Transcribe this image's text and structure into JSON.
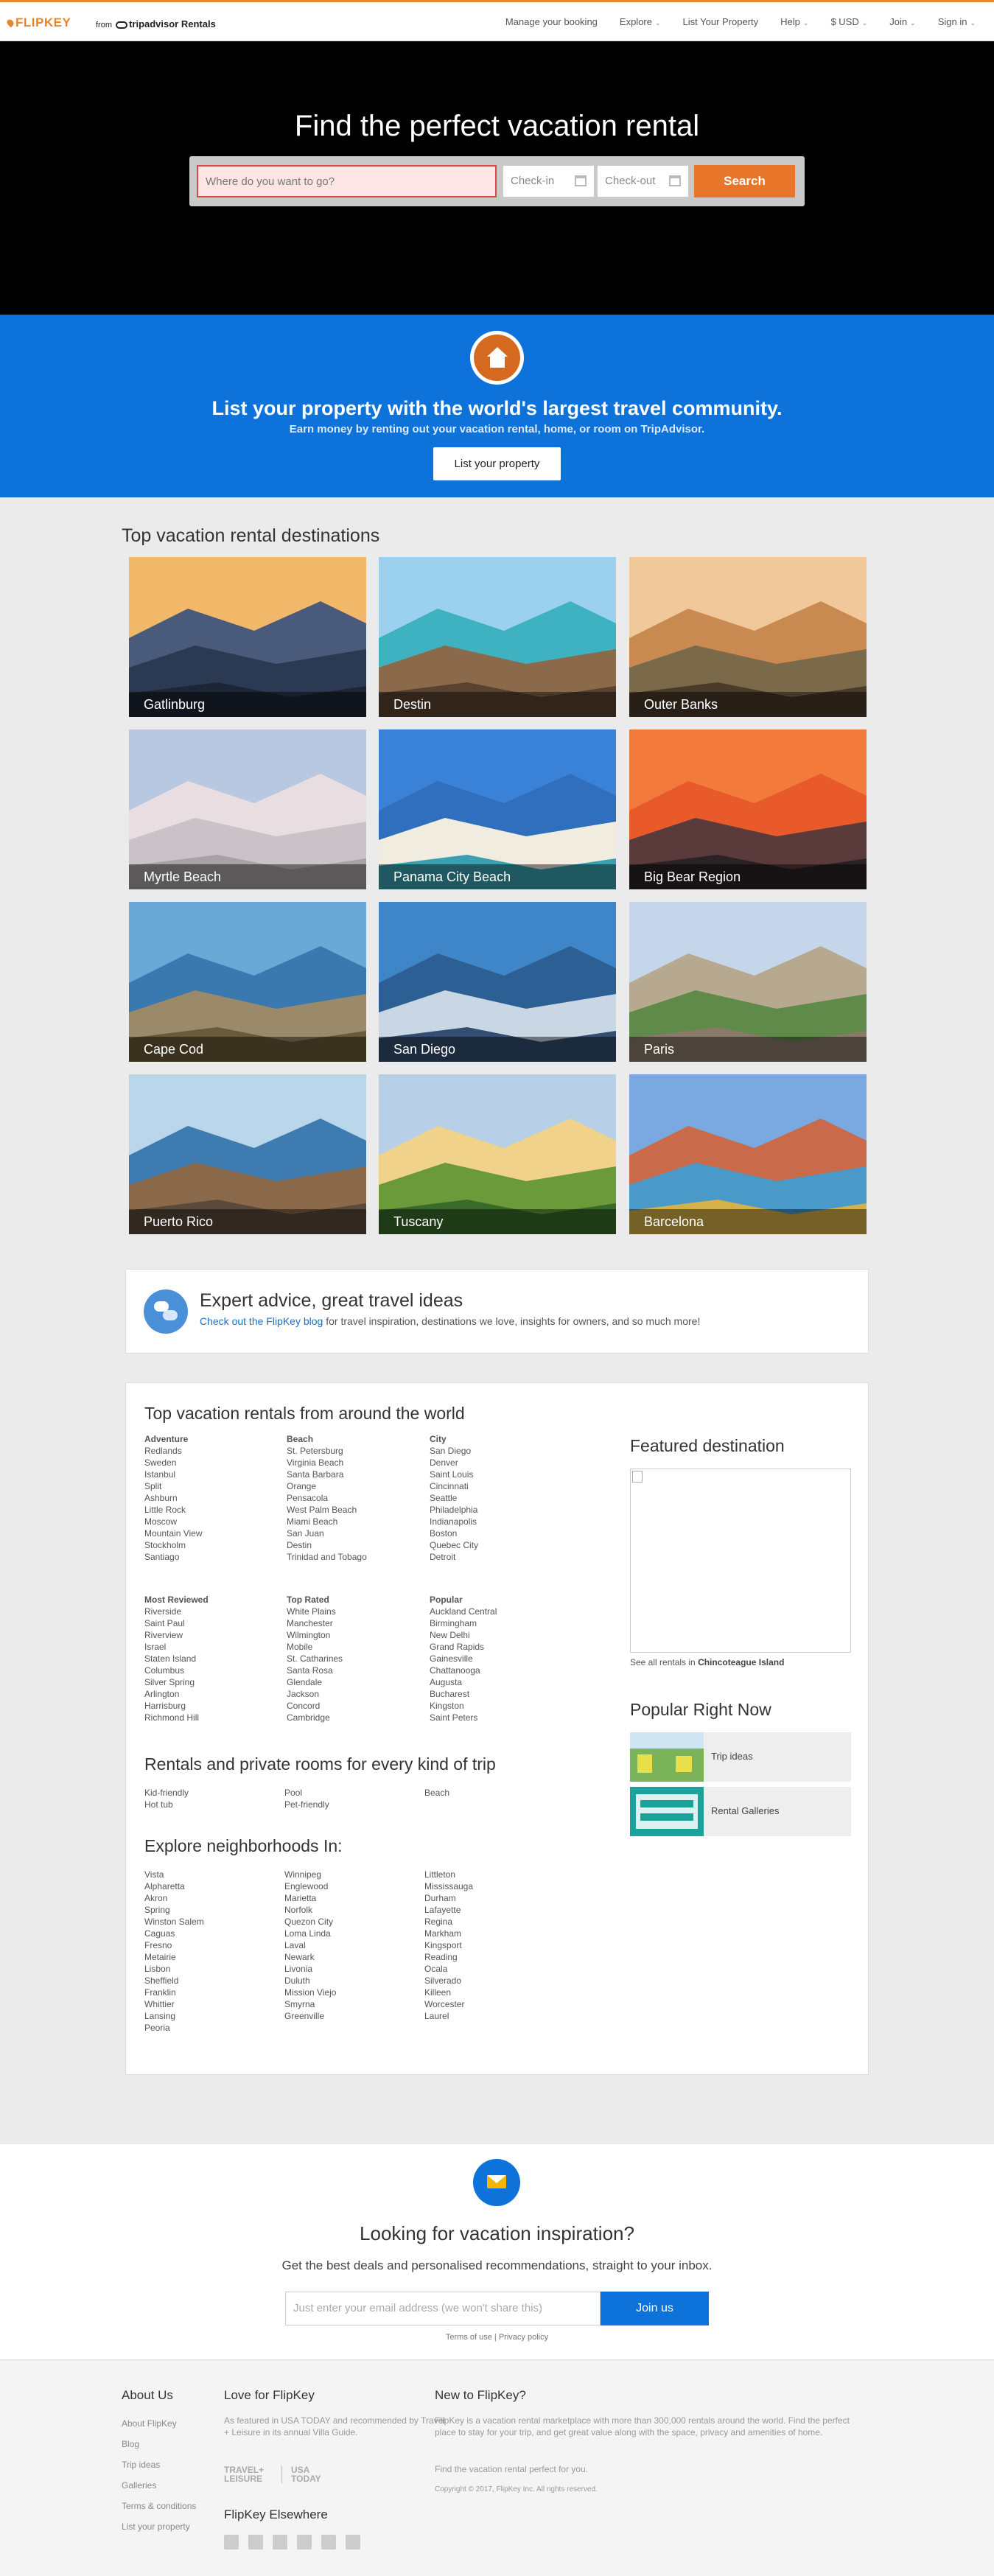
{
  "header": {
    "brand": "FLIPKEY",
    "from": "from",
    "partner": "tripadvisor Rentals",
    "nav": [
      {
        "label": "Manage your booking",
        "chev": false
      },
      {
        "label": "Explore",
        "chev": true
      },
      {
        "label": "List Your Property",
        "chev": false
      },
      {
        "label": "Help",
        "chev": true
      },
      {
        "label": "$ USD",
        "chev": true
      },
      {
        "label": "Join",
        "chev": true
      },
      {
        "label": "Sign in",
        "chev": true
      }
    ]
  },
  "hero": {
    "title": "Find the perfect vacation rental",
    "where_placeholder": "Where do you want to go?",
    "checkin": "Check-in",
    "checkout": "Check-out",
    "search_label": "Search"
  },
  "list_property": {
    "title": "List your property with the world's largest travel community.",
    "subtitle": "Earn money by renting out your vacation rental, home, or room on TripAdvisor.",
    "button": "List your property"
  },
  "destinations": {
    "title": "Top vacation rental destinations",
    "tiles": [
      "Gatlinburg",
      "Destin",
      "Outer Banks",
      "Myrtle Beach",
      "Panama City Beach",
      "Big Bear Region",
      "Cape Cod",
      "San Diego",
      "Paris",
      "Puerto Rico",
      "Tuscany",
      "Barcelona"
    ]
  },
  "advice": {
    "title": "Expert advice, great travel ideas",
    "link": "Check out the FlipKey blog",
    "text": " for travel inspiration, destinations we love, insights for owners, and so much more!"
  },
  "world": {
    "title": "Top vacation rentals from around the world",
    "adventure": {
      "heading": "Adventure",
      "items": [
        "Redlands",
        "Sweden",
        "Istanbul",
        "Split",
        "Ashburn",
        "Little Rock",
        "Moscow",
        "Mountain View",
        "Stockholm",
        "Santiago"
      ]
    },
    "beach": {
      "heading": "Beach",
      "items": [
        "St. Petersburg",
        "Virginia Beach",
        "Santa Barbara",
        "Orange",
        "Pensacola",
        "West Palm Beach",
        "Miami Beach",
        "San Juan",
        "Destin",
        "Trinidad and Tobago"
      ]
    },
    "city": {
      "heading": "City",
      "items": [
        "San Diego",
        "Denver",
        "Saint Louis",
        "Cincinnati",
        "Seattle",
        "Philadelphia",
        "Indianapolis",
        "Boston",
        "Quebec City",
        "Detroit"
      ]
    },
    "most_reviewed": {
      "heading": "Most Reviewed",
      "items": [
        "Riverside",
        "Saint Paul",
        "Riverview",
        "Israel",
        "Staten Island",
        "Columbus",
        "Silver Spring",
        "Arlington",
        "Harrisburg",
        "Richmond Hill"
      ]
    },
    "top_rated": {
      "heading": "Top Rated",
      "items": [
        "White Plains",
        "Manchester",
        "Wilmington",
        "Mobile",
        "St. Catharines",
        "Santa Rosa",
        "Glendale",
        "Jackson",
        "Concord",
        "Cambridge"
      ]
    },
    "popular": {
      "heading": "Popular",
      "items": [
        "Auckland Central",
        "Birmingham",
        "New Delhi",
        "Grand Rapids",
        "Gainesville",
        "Chattanooga",
        "Augusta",
        "Bucharest",
        "Kingston",
        "Saint Peters"
      ]
    }
  },
  "trip": {
    "title": "Rentals and private rooms for every kind of trip",
    "col1": [
      "Kid-friendly",
      "Hot tub"
    ],
    "col2": [
      "Pool",
      "Pet-friendly"
    ],
    "col3": [
      "Beach"
    ]
  },
  "neighborhoods": {
    "title": "Explore neighborhoods In:",
    "col1": [
      "Vista",
      "Alpharetta",
      "Akron",
      "Spring",
      "Winston Salem",
      "Caguas",
      "Fresno",
      "Metairie",
      "Lisbon",
      "Sheffield",
      "Franklin",
      "Whittier",
      "Lansing",
      "Peoria"
    ],
    "col2": [
      "Winnipeg",
      "Englewood",
      "Marietta",
      "Norfolk",
      "Quezon City",
      "Loma Linda",
      "Laval",
      "Newark",
      "Livonia",
      "Duluth",
      "Mission Viejo",
      "Smyrna",
      "Greenville"
    ],
    "col3": [
      "Littleton",
      "Mississauga",
      "Durham",
      "Lafayette",
      "Regina",
      "Markham",
      "Kingsport",
      "Reading",
      "Ocala",
      "Silverado",
      "Killeen",
      "Worcester",
      "Laurel"
    ]
  },
  "featured": {
    "title": "Featured destination",
    "link_prefix": "See all rentals in ",
    "link_place": "Chincoteague Island"
  },
  "popular_now": {
    "title": "Popular Right Now",
    "items": [
      "Trip ideas",
      "Rental Galleries"
    ]
  },
  "newsletter": {
    "title": "Looking for vacation inspiration?",
    "subtitle": "Get the best deals and personalised recommendations, straight to your inbox.",
    "placeholder": "Just enter your email address (we won't share this)",
    "button": "Join us",
    "terms": "Terms of use | Privacy policy"
  },
  "footer": {
    "about_title": "About Us",
    "about_links": [
      "About FlipKey",
      "Blog",
      "Trip ideas",
      "Galleries",
      "Terms & conditions",
      "List your property"
    ],
    "love_title": "Love for FlipKey",
    "love_text": "As featured in USA TODAY and recommended by Travel + Leisure in its annual Villa Guide.",
    "press_1": "TRAVEL+ LEISURE",
    "press_2": "USA TODAY",
    "elsewhere_title": "FlipKey Elsewhere",
    "social": [
      "facebook-icon",
      "twitter-icon",
      "google-plus-icon",
      "pinterest-icon",
      "instagram-icon",
      "linkedin-icon"
    ],
    "new_title": "New to FlipKey?",
    "new_text": "FlipKey is a vacation rental marketplace with more than 300,000 rentals around the world. Find the perfect place to stay for your trip, and get great value along with the space, privacy and amenities of home.",
    "new_text2": "Find the vacation rental perfect for you.",
    "copyright": "Copyright © 2017, FlipKey Inc. All rights reserved."
  },
  "colors": {
    "accent": "#e8762a",
    "brand_blue": "#0d72d9",
    "hero_bg": "#000000",
    "grey_bg": "#ebebeb"
  }
}
